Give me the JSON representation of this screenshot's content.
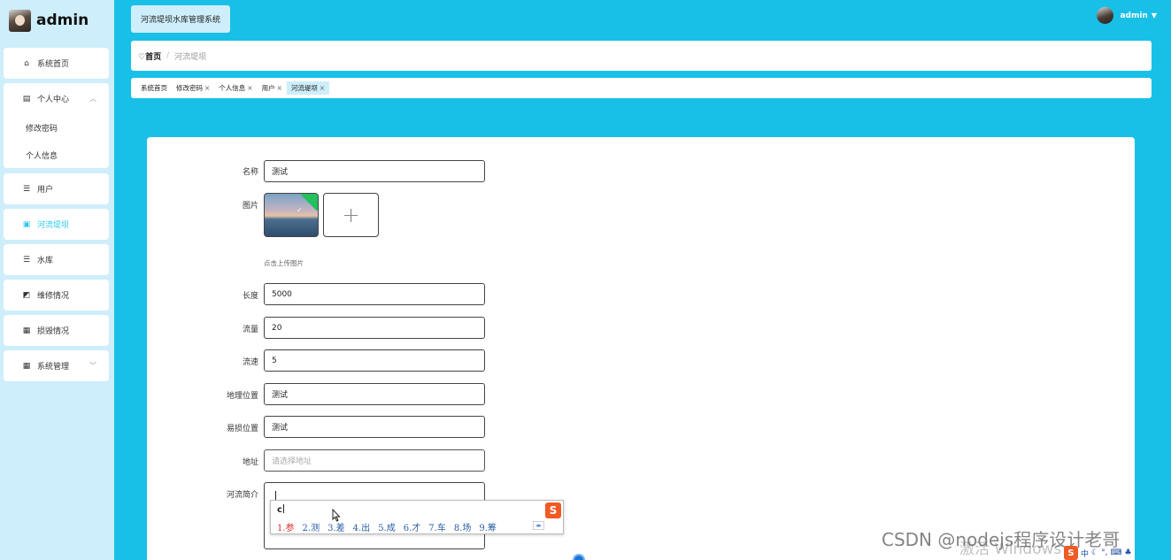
{
  "sidebar": {
    "username": "admin",
    "items": [
      {
        "label": "系统首页",
        "icon": "home-icon"
      },
      {
        "label": "个人中心",
        "icon": "calendar-icon",
        "expanded": true,
        "children": [
          "修改密码",
          "个人信息"
        ]
      },
      {
        "label": "用户",
        "icon": "list-icon"
      },
      {
        "label": "河流堤坝",
        "icon": "clipboard-icon",
        "active": true
      },
      {
        "label": "水库",
        "icon": "list-icon"
      },
      {
        "label": "维修情况",
        "icon": "chart-icon"
      },
      {
        "label": "损毁情况",
        "icon": "grid-icon"
      },
      {
        "label": "系统管理",
        "icon": "grid-icon",
        "collapsible": true
      }
    ]
  },
  "header": {
    "system_title": "河流堤坝水库管理系统",
    "user_name": "admin"
  },
  "breadcrumb": {
    "home": "首页",
    "separator": "/",
    "current": "河流堤坝"
  },
  "tabs": [
    {
      "label": "系统首页",
      "closable": false
    },
    {
      "label": "修改密码",
      "closable": true
    },
    {
      "label": "个人信息",
      "closable": true
    },
    {
      "label": "用户",
      "closable": true
    },
    {
      "label": "河流堤坝",
      "closable": true,
      "active": true
    }
  ],
  "tab_close_glyph": "×",
  "form": {
    "name_label": "名称",
    "name_value": "测试",
    "image_label": "图片",
    "upload_hint": "点击上传图片",
    "length_label": "长度",
    "length_value": "5000",
    "flow_label": "流量",
    "flow_value": "20",
    "speed_label": "流速",
    "speed_value": "5",
    "location_label": "地理位置",
    "location_value": "测试",
    "vulnerable_label": "易损位置",
    "vulnerable_value": "测试",
    "address_label": "地址",
    "address_placeholder": "请选择地址",
    "intro_label": "河流简介",
    "intro_value": ""
  },
  "ime": {
    "typed": "c",
    "candidates": [
      "1.参",
      "2.测",
      "3.差",
      "4.出",
      "5.成",
      "6.才",
      "7.车",
      "8.场",
      "9.筹"
    ],
    "logo": "S"
  },
  "watermark": "CSDN @nodejs程序设计老哥",
  "windows_activation": "激活 Windows",
  "tray": {
    "lang": "中"
  },
  "colors": {
    "header_bg": "#18c0e8",
    "sidebar_bg": "#cdeefa",
    "active_text": "#2ec8ec",
    "upload_badge": "#23c05d"
  }
}
